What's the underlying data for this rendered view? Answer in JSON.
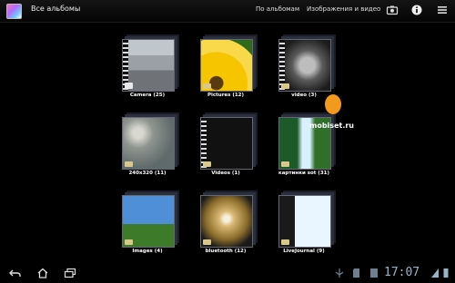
{
  "header": {
    "title": "Все альбомы",
    "by_albums": "По альбомам",
    "images_and_video": "Изображения и видео"
  },
  "albums": [
    {
      "label": "Camera (25)"
    },
    {
      "label": "Pictures (12)"
    },
    {
      "label": "video (3)"
    },
    {
      "label": "240x320 (11)"
    },
    {
      "label": "Videos (1)"
    },
    {
      "label": "картинки sot (31)"
    },
    {
      "label": "Images (4)"
    },
    {
      "label": "bluetooth (12)"
    },
    {
      "label": "LiveJournal (9)"
    }
  ],
  "watermark": "mobiset.ru",
  "status": {
    "time": "17:07"
  }
}
